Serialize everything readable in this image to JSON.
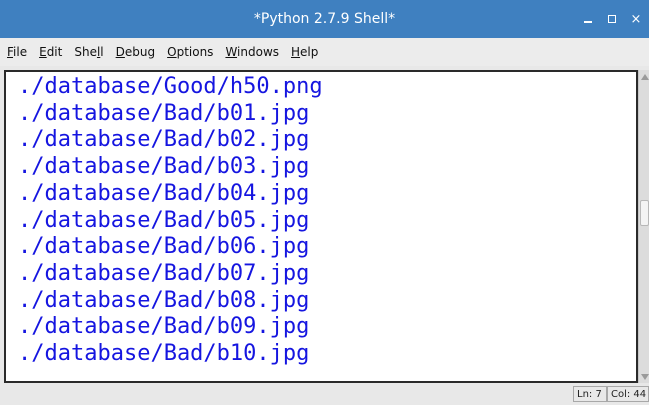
{
  "window": {
    "title": "*Python 2.7.9 Shell*",
    "controls": {
      "close_glyph": "×"
    }
  },
  "menu": {
    "items": [
      {
        "label": "File",
        "mnemonic": "F",
        "rest": "ile",
        "prefix": ""
      },
      {
        "label": "Edit",
        "mnemonic": "E",
        "rest": "dit",
        "prefix": ""
      },
      {
        "label": "Shell",
        "mnemonic": "l",
        "rest": "l",
        "prefix": "She"
      },
      {
        "label": "Debug",
        "mnemonic": "D",
        "rest": "ebug",
        "prefix": ""
      },
      {
        "label": "Options",
        "mnemonic": "O",
        "rest": "ptions",
        "prefix": ""
      },
      {
        "label": "Windows",
        "mnemonic": "W",
        "rest": "indows",
        "prefix": ""
      },
      {
        "label": "Help",
        "mnemonic": "H",
        "rest": "elp",
        "prefix": ""
      }
    ]
  },
  "editor": {
    "text_color": "#1515e0",
    "lines": [
      "./database/Good/h50.png",
      "./database/Bad/b01.jpg",
      "./database/Bad/b02.jpg",
      "./database/Bad/b03.jpg",
      "./database/Bad/b04.jpg",
      "./database/Bad/b05.jpg",
      "./database/Bad/b06.jpg",
      "./database/Bad/b07.jpg",
      "./database/Bad/b08.jpg",
      "./database/Bad/b09.jpg",
      "./database/Bad/b10.jpg"
    ]
  },
  "status": {
    "line": "Ln: 7",
    "col": "Col: 44"
  },
  "colors": {
    "titlebar": "#3f80c0",
    "menubar": "#ececec"
  }
}
